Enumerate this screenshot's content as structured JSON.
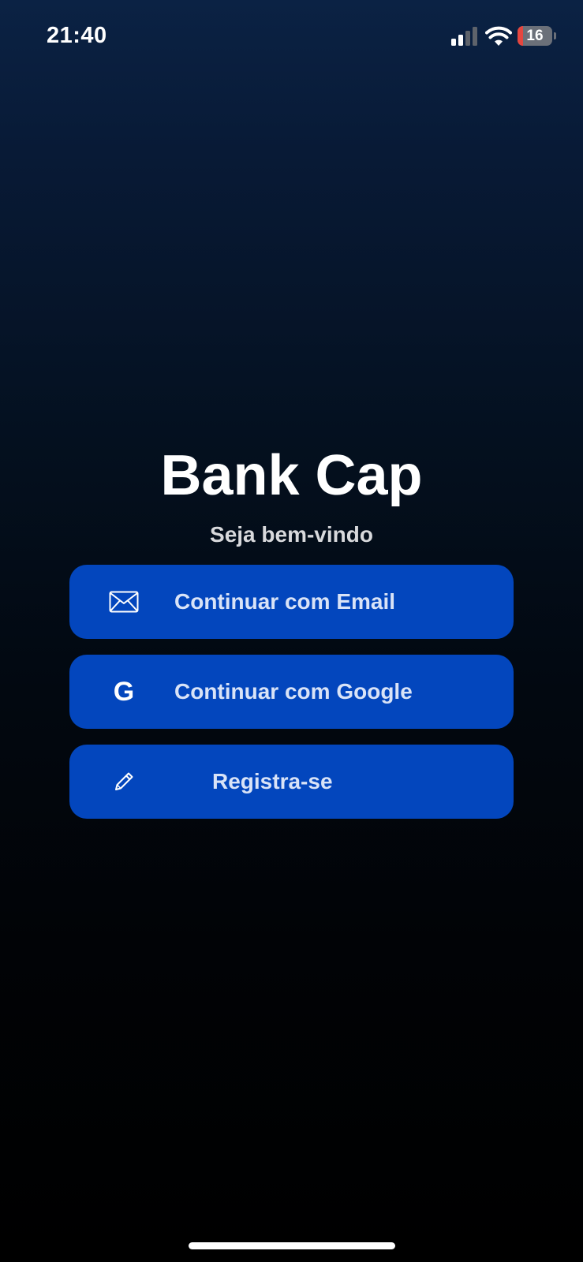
{
  "status_bar": {
    "time": "21:40",
    "battery_level": "16",
    "battery_fraction": 0.16,
    "signal_icon": "cellular-signal-icon",
    "wifi_icon": "wifi-icon"
  },
  "app": {
    "title": "Bank Cap",
    "subtitle": "Seja bem-vindo"
  },
  "buttons": {
    "email": {
      "label": "Continuar com Email",
      "icon": "envelope-icon"
    },
    "google": {
      "label": "Continuar com Google",
      "icon": "google-icon",
      "icon_glyph": "G"
    },
    "register": {
      "label": "Registra-se",
      "icon": "pencil-icon"
    }
  },
  "colors": {
    "button_bg": "#0346bd",
    "button_text": "#d9e3f7",
    "battery_low": "#e5463f",
    "background_top": "#0b2244",
    "background_bottom": "#000000"
  }
}
